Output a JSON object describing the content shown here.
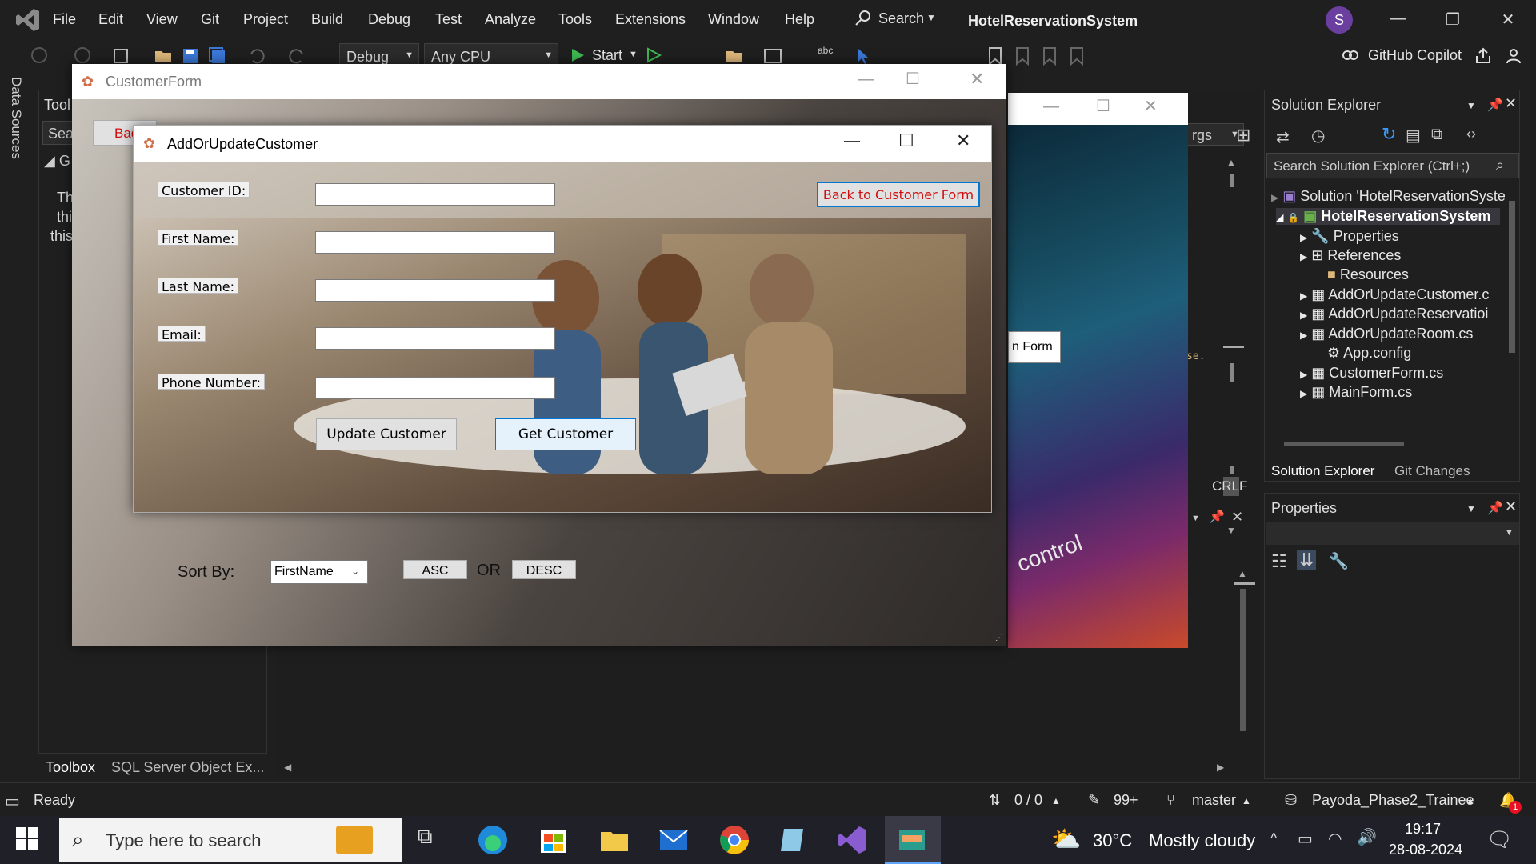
{
  "menu": {
    "items": [
      "File",
      "Edit",
      "View",
      "Git",
      "Project",
      "Build",
      "Debug",
      "Test",
      "Analyze",
      "Tools",
      "Extensions",
      "Window",
      "Help"
    ],
    "search_label": "Search",
    "solution_title": "HotelReservationSystem",
    "avatar_initial": "S"
  },
  "toolbar": {
    "config": "Debug",
    "platform": "Any CPU",
    "start_label": "Start",
    "copilot_label": "GitHub Copilot"
  },
  "left_strip": {
    "data_sources": "Data Sources"
  },
  "toolbox": {
    "title_partial": "Tool",
    "search_partial": "Sea",
    "group_partial": "G",
    "text_lines": [
      "Th",
      "thi",
      "this"
    ],
    "tabs": [
      "Toolbox",
      "SQL Server Object Ex..."
    ]
  },
  "editor": {
    "dropdown_partial": "rgs",
    "crlf": "CRLF",
    "code_partial": "se."
  },
  "solution_explorer": {
    "title": "Solution Explorer",
    "search_placeholder": "Search Solution Explorer (Ctrl+;)",
    "items": [
      {
        "label": "Solution 'HotelReservationSyste"
      },
      {
        "label": "HotelReservationSystem"
      },
      {
        "label": "Properties"
      },
      {
        "label": "References"
      },
      {
        "label": "Resources"
      },
      {
        "label": "AddOrUpdateCustomer.c"
      },
      {
        "label": "AddOrUpdateReservatioi"
      },
      {
        "label": "AddOrUpdateRoom.cs"
      },
      {
        "label": "App.config"
      },
      {
        "label": "CustomerForm.cs"
      },
      {
        "label": "MainForm.cs"
      }
    ],
    "tabs": [
      "Solution Explorer",
      "Git Changes"
    ]
  },
  "properties": {
    "title": "Properties"
  },
  "status": {
    "ready": "Ready",
    "line_col": "0 / 0",
    "errors": "99+",
    "branch": "master",
    "repo": "Payoda_Phase2_Trainee",
    "notifications": "1"
  },
  "taskbar": {
    "search_placeholder": "Type here to search",
    "weather_temp": "30°C",
    "weather_desc": "Mostly cloudy",
    "time": "19:17",
    "date": "28-08-2024"
  },
  "main_form": {
    "button_partial": "n Form",
    "bg_text": "control"
  },
  "customer_form": {
    "title": "CustomerForm",
    "back_partial": "Bac",
    "sort_label": "Sort By:",
    "sort_value": "FirstName",
    "asc_label": "ASC",
    "or_label": "OR",
    "desc_label": "DESC"
  },
  "auc_form": {
    "title": "AddOrUpdateCustomer",
    "labels": [
      "Customer ID:",
      "First Name:",
      "Last Name:",
      "Email:",
      "Phone Number:"
    ],
    "values": [
      "",
      "",
      "",
      "",
      ""
    ],
    "update_button": "Update Customer",
    "get_button": "Get Customer",
    "back_button": "Back to Customer Form"
  },
  "colors": {
    "vs_bg": "#1f1f1f",
    "accent_red": "#e81123",
    "selection_blue": "#0078d4",
    "vs_purple": "#6b3fa0"
  }
}
